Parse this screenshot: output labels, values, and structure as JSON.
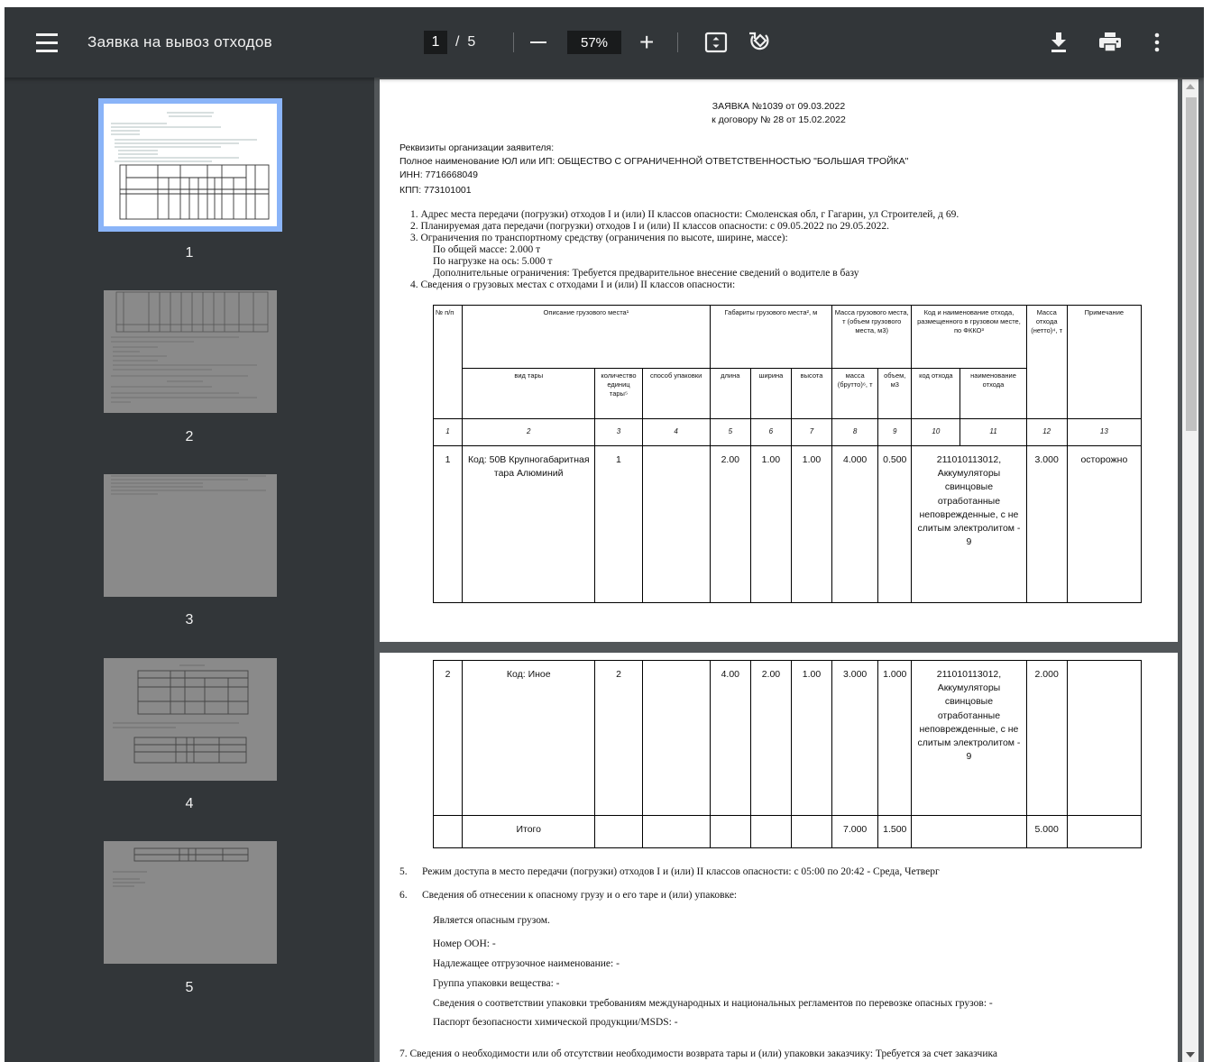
{
  "toolbar": {
    "title": "Заявка на вывоз отходов",
    "current_page": "1",
    "page_separator": "/",
    "total_pages": "5",
    "zoom": "57%",
    "zoom_in_label": "+"
  },
  "thumbnails": [
    {
      "label": "1"
    },
    {
      "label": "2"
    },
    {
      "label": "3"
    },
    {
      "label": "4"
    },
    {
      "label": "5"
    }
  ],
  "page1": {
    "title_line1": "ЗАЯВКА №1039 от 09.03.2022",
    "title_line2": "к договору № 28 от 15.02.2022",
    "requisites_heading": "Реквизиты организации заявителя:",
    "org_full_name": "Полное наименование ЮЛ или ИП: ОБЩЕСТВО С ОГРАНИЧЕННОЙ ОТВЕТСТВЕННОСТЬЮ \"БОЛЬШАЯ ТРОЙКА\"",
    "inn": "ИНН: 7716668049",
    "kpp": "КПП: 773101001",
    "item1": "1. Адрес места передачи (погрузки) отходов I и (или) II классов опасности: Смоленская обл, г Гагарин, ул Строителей, д 69.",
    "item2": "2. Планируемая дата передачи (погрузки) отходов I и (или) II классов опасности: с 09.05.2022 по 29.05.2022.",
    "item3": "3. Ограничения по транспортному средству (ограничения по высоте, ширине, массе):",
    "item3_mass": "По общей массе: 2.000 т",
    "item3_axle": "По нагрузке на ось: 5.000 т",
    "item3_extra": "Дополнительные ограничения: Требуется предварительное внесение сведений о водителе в базу",
    "item4": "4. Сведения о грузовых местах с отходами I и (или) II классов опасности:"
  },
  "table": {
    "headers": {
      "num": "№ п/п",
      "description": "Описание грузового места¹",
      "dimensions": "Габариты грузового места², м",
      "mass": "Масса грузового места, т (объем грузового места, м3)",
      "waste_code_name": "Код и наименование отхода, размещенного в грузовом месте, по ФККО³",
      "waste_mass": "Масса отхода (нетто)⁴, т",
      "note": "Примечание",
      "container_type": "вид тары",
      "quantity": "количество единиц тары⁵",
      "packing": "способ упаковки",
      "length": "длина",
      "width": "ширина",
      "height": "высота",
      "gross": "масса (брутто)⁶, т",
      "volume": "объем, м3",
      "waste_code": "код отхода",
      "waste_name": "наименование отхода"
    },
    "column_numbers": [
      "1",
      "2",
      "3",
      "4",
      "5",
      "6",
      "7",
      "8",
      "9",
      "10",
      "11",
      "12",
      "13"
    ],
    "rows": [
      {
        "n": "1",
        "type": "Код: 50В Крупногабаритная тара Алюминий",
        "qty": "1",
        "pack": "",
        "len": "2.00",
        "wid": "1.00",
        "hei": "1.00",
        "gross": "4.000",
        "vol": "0.500",
        "waste": "211010113012, Аккумуляторы свинцовые отработанные неповрежденные, с не слитым электролитом - 9",
        "net": "3.000",
        "note": "осторожно"
      },
      {
        "n": "2",
        "type": "Код: Иное",
        "qty": "2",
        "pack": "",
        "len": "4.00",
        "wid": "2.00",
        "hei": "1.00",
        "gross": "3.000",
        "vol": "1.000",
        "waste": "211010113012, Аккумуляторы свинцовые отработанные неповрежденные, с не слитым электролитом - 9",
        "net": "2.000",
        "note": ""
      }
    ],
    "total": {
      "label": "Итого",
      "gross": "7.000",
      "vol": "1.500",
      "net": "5.000"
    }
  },
  "page2": {
    "item5_num": "5.",
    "item5": "Режим доступа в место передачи (погрузки) отходов I и (или) II классов опасности: с 05:00 по 20:42 - Среда, Четверг",
    "item6_num": "6.",
    "item6": "Сведения об отнесении к опасному грузу и о его таре и (или) упаковке:",
    "dangerous": "Является опасным грузом.",
    "un_number": "Номер ООН: -",
    "shipping_name": "Надлежащее отгрузочное наименование: -",
    "packing_group": "Группа упаковки вещества: -",
    "compliance": "Сведения о соответствии упаковки требованиям международных и национальных регламентов по перевозке опасных грузов: -",
    "msds": "Паспорт безопасности химической продукции/MSDS:  -",
    "item7": "7. Сведения о необходимости или об отсутствии необходимости возврата тары и (или) упаковки заказчику: Требуется за счет заказчика"
  }
}
